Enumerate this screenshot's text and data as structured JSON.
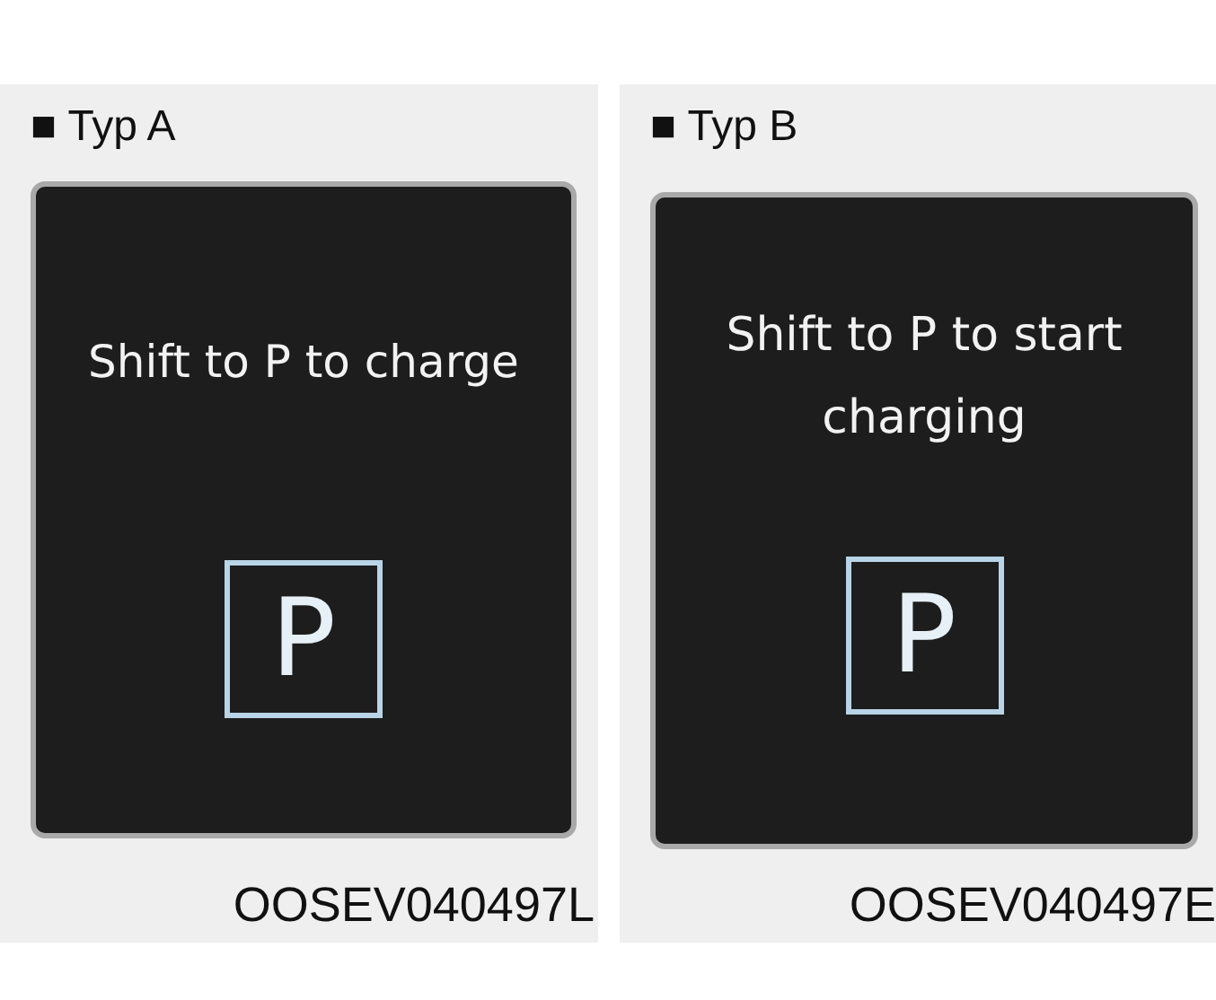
{
  "panels": [
    {
      "label": "■ Typ A",
      "message": "Shift to P to charge",
      "gear": "P",
      "code": "OOSEV040497L"
    },
    {
      "label": "■ Typ B",
      "message": "Shift to P to start charging",
      "gear": "P",
      "code": "OOSEV040497E"
    }
  ]
}
